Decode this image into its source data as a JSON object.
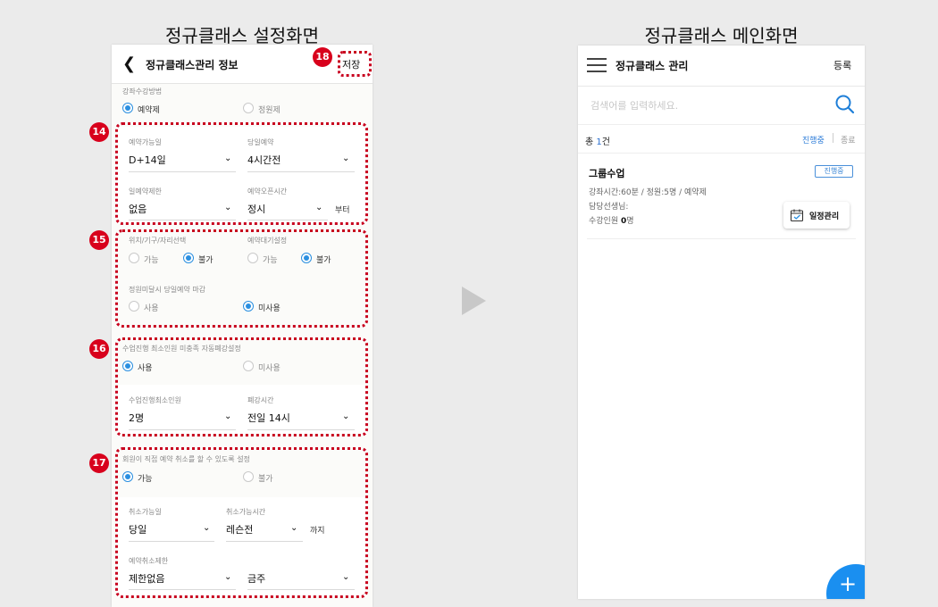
{
  "captions": {
    "left": "정규클래스 설정화면",
    "right": "정규클래스 메인화면"
  },
  "settings": {
    "title": "정규클래스관리 정보",
    "save": "저장",
    "method": {
      "label": "강좌수강방법",
      "opt1": "예약제",
      "opt2": "정원제"
    },
    "s14": {
      "avail_label": "예약가능일",
      "avail_value": "D+14일",
      "same_label": "당일예약",
      "same_value": "4시간전",
      "daily_label": "일예약제한",
      "daily_value": "없음",
      "open_label": "예약오픈시간",
      "open_value": "정시",
      "open_suffix": "부터"
    },
    "s15": {
      "seat_label": "위치/기구/자리선택",
      "seat_opt1": "가능",
      "seat_opt2": "불가",
      "wait_label": "예약대기설정",
      "wait_opt1": "가능",
      "wait_opt2": "불가",
      "close_label": "정원미달시 당일예약 마감",
      "close_opt1": "사용",
      "close_opt2": "미사용"
    },
    "s16": {
      "auto_label": "수업진행 최소인원 미충족 자동폐강설정",
      "auto_opt1": "사용",
      "auto_opt2": "미사용",
      "min_label": "수업진행최소인원",
      "min_value": "2명",
      "cancel_label": "폐강시간",
      "cancel_value": "전일 14시"
    },
    "s17": {
      "member_label": "회원이 직접 예약 취소를 할 수 있도록 설정",
      "member_opt1": "가능",
      "member_opt2": "불가",
      "cday_label": "취소가능일",
      "cday_value": "당일",
      "ctime_label": "취소가능시간",
      "ctime_value": "레슨전",
      "ctime_suffix": "까지",
      "climit_label": "예약취소제한",
      "climit_value": "제한없음",
      "climit_value2": "금주"
    },
    "badges": {
      "b14": "14",
      "b15": "15",
      "b16": "16",
      "b17": "17",
      "b18": "18"
    }
  },
  "main": {
    "title": "정규클래스 관리",
    "register": "등록",
    "search_placeholder": "검색어를 입력하세요.",
    "total_prefix": "총 ",
    "total_count": "1",
    "total_suffix": "건",
    "filter_active": "진행중",
    "filter_ended": "종료",
    "item": {
      "name": "그룹수업",
      "status": "진행중",
      "info1": "강좌시간:60분 / 정원:5명 / 예약제",
      "info2": "담당선생님:",
      "info3_prefix": "수강인원 ",
      "info3_count": "0",
      "info3_suffix": "명",
      "schedule_button": "일정관리"
    }
  },
  "colors": {
    "accent": "#2b8fe0",
    "highlight": "#c8001e",
    "fab": "#1a8ff0"
  }
}
